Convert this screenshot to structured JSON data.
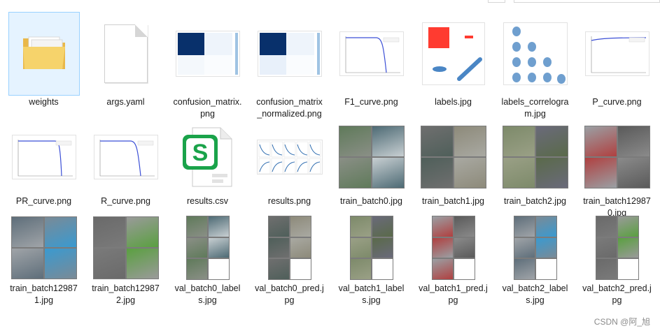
{
  "files": [
    {
      "name": "weights",
      "kind": "folder"
    },
    {
      "name": "args.yaml",
      "kind": "doc"
    },
    {
      "name": "confusion_matrix.png",
      "kind": "cm"
    },
    {
      "name": "confusion_matrix_normalized.png",
      "kind": "cm"
    },
    {
      "name": "F1_curve.png",
      "kind": "curve"
    },
    {
      "name": "labels.jpg",
      "kind": "labels"
    },
    {
      "name": "labels_correlogram.jpg",
      "kind": "correlogram"
    },
    {
      "name": "P_curve.png",
      "kind": "curve"
    },
    {
      "name": "PR_curve.png",
      "kind": "curve"
    },
    {
      "name": "R_curve.png",
      "kind": "curve"
    },
    {
      "name": "results.csv",
      "kind": "csv"
    },
    {
      "name": "results.png",
      "kind": "results"
    },
    {
      "name": "train_batch0.jpg",
      "kind": "photo"
    },
    {
      "name": "train_batch1.jpg",
      "kind": "photo"
    },
    {
      "name": "train_batch2.jpg",
      "kind": "photo"
    },
    {
      "name": "train_batch129870.jpg",
      "kind": "photo"
    },
    {
      "name": "train_batch129871.jpg",
      "kind": "photo"
    },
    {
      "name": "train_batch129872.jpg",
      "kind": "photo"
    },
    {
      "name": "val_batch0_labels.jpg",
      "kind": "val"
    },
    {
      "name": "val_batch0_pred.jpg",
      "kind": "val"
    },
    {
      "name": "val_batch1_labels.jpg",
      "kind": "val"
    },
    {
      "name": "val_batch1_pred.jpg",
      "kind": "val"
    },
    {
      "name": "val_batch2_labels.jpg",
      "kind": "val"
    },
    {
      "name": "val_batch2_pred.jpg",
      "kind": "val"
    }
  ],
  "selected_index": 0,
  "csv_icon_letter": "S",
  "watermark": "CSDN @阿_旭",
  "colors": {
    "folder": "#f6d36b",
    "selection": "#e5f3ff",
    "cm_dark": "#08306b",
    "curve": "#3b4fd6",
    "csv_green": "#1aa34a",
    "labels_red": "#ff3b30"
  }
}
